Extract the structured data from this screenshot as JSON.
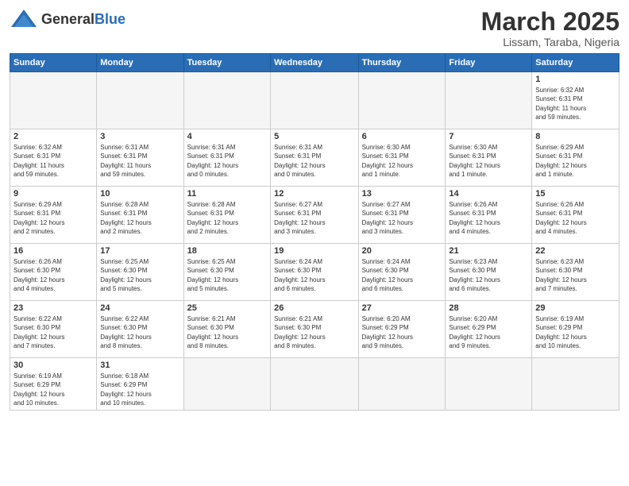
{
  "header": {
    "logo_general": "General",
    "logo_blue": "Blue",
    "month_year": "March 2025",
    "location": "Lissam, Taraba, Nigeria"
  },
  "weekdays": [
    "Sunday",
    "Monday",
    "Tuesday",
    "Wednesday",
    "Thursday",
    "Friday",
    "Saturday"
  ],
  "weeks": [
    [
      {
        "day": "",
        "info": ""
      },
      {
        "day": "",
        "info": ""
      },
      {
        "day": "",
        "info": ""
      },
      {
        "day": "",
        "info": ""
      },
      {
        "day": "",
        "info": ""
      },
      {
        "day": "",
        "info": ""
      },
      {
        "day": "1",
        "info": "Sunrise: 6:32 AM\nSunset: 6:31 PM\nDaylight: 11 hours\nand 59 minutes."
      }
    ],
    [
      {
        "day": "2",
        "info": "Sunrise: 6:32 AM\nSunset: 6:31 PM\nDaylight: 11 hours\nand 59 minutes."
      },
      {
        "day": "3",
        "info": "Sunrise: 6:31 AM\nSunset: 6:31 PM\nDaylight: 11 hours\nand 59 minutes."
      },
      {
        "day": "4",
        "info": "Sunrise: 6:31 AM\nSunset: 6:31 PM\nDaylight: 12 hours\nand 0 minutes."
      },
      {
        "day": "5",
        "info": "Sunrise: 6:31 AM\nSunset: 6:31 PM\nDaylight: 12 hours\nand 0 minutes."
      },
      {
        "day": "6",
        "info": "Sunrise: 6:30 AM\nSunset: 6:31 PM\nDaylight: 12 hours\nand 1 minute."
      },
      {
        "day": "7",
        "info": "Sunrise: 6:30 AM\nSunset: 6:31 PM\nDaylight: 12 hours\nand 1 minute."
      },
      {
        "day": "8",
        "info": "Sunrise: 6:29 AM\nSunset: 6:31 PM\nDaylight: 12 hours\nand 1 minute."
      }
    ],
    [
      {
        "day": "9",
        "info": "Sunrise: 6:29 AM\nSunset: 6:31 PM\nDaylight: 12 hours\nand 2 minutes."
      },
      {
        "day": "10",
        "info": "Sunrise: 6:28 AM\nSunset: 6:31 PM\nDaylight: 12 hours\nand 2 minutes."
      },
      {
        "day": "11",
        "info": "Sunrise: 6:28 AM\nSunset: 6:31 PM\nDaylight: 12 hours\nand 2 minutes."
      },
      {
        "day": "12",
        "info": "Sunrise: 6:27 AM\nSunset: 6:31 PM\nDaylight: 12 hours\nand 3 minutes."
      },
      {
        "day": "13",
        "info": "Sunrise: 6:27 AM\nSunset: 6:31 PM\nDaylight: 12 hours\nand 3 minutes."
      },
      {
        "day": "14",
        "info": "Sunrise: 6:26 AM\nSunset: 6:31 PM\nDaylight: 12 hours\nand 4 minutes."
      },
      {
        "day": "15",
        "info": "Sunrise: 6:26 AM\nSunset: 6:31 PM\nDaylight: 12 hours\nand 4 minutes."
      }
    ],
    [
      {
        "day": "16",
        "info": "Sunrise: 6:26 AM\nSunset: 6:30 PM\nDaylight: 12 hours\nand 4 minutes."
      },
      {
        "day": "17",
        "info": "Sunrise: 6:25 AM\nSunset: 6:30 PM\nDaylight: 12 hours\nand 5 minutes."
      },
      {
        "day": "18",
        "info": "Sunrise: 6:25 AM\nSunset: 6:30 PM\nDaylight: 12 hours\nand 5 minutes."
      },
      {
        "day": "19",
        "info": "Sunrise: 6:24 AM\nSunset: 6:30 PM\nDaylight: 12 hours\nand 6 minutes."
      },
      {
        "day": "20",
        "info": "Sunrise: 6:24 AM\nSunset: 6:30 PM\nDaylight: 12 hours\nand 6 minutes."
      },
      {
        "day": "21",
        "info": "Sunrise: 6:23 AM\nSunset: 6:30 PM\nDaylight: 12 hours\nand 6 minutes."
      },
      {
        "day": "22",
        "info": "Sunrise: 6:23 AM\nSunset: 6:30 PM\nDaylight: 12 hours\nand 7 minutes."
      }
    ],
    [
      {
        "day": "23",
        "info": "Sunrise: 6:22 AM\nSunset: 6:30 PM\nDaylight: 12 hours\nand 7 minutes."
      },
      {
        "day": "24",
        "info": "Sunrise: 6:22 AM\nSunset: 6:30 PM\nDaylight: 12 hours\nand 8 minutes."
      },
      {
        "day": "25",
        "info": "Sunrise: 6:21 AM\nSunset: 6:30 PM\nDaylight: 12 hours\nand 8 minutes."
      },
      {
        "day": "26",
        "info": "Sunrise: 6:21 AM\nSunset: 6:30 PM\nDaylight: 12 hours\nand 8 minutes."
      },
      {
        "day": "27",
        "info": "Sunrise: 6:20 AM\nSunset: 6:29 PM\nDaylight: 12 hours\nand 9 minutes."
      },
      {
        "day": "28",
        "info": "Sunrise: 6:20 AM\nSunset: 6:29 PM\nDaylight: 12 hours\nand 9 minutes."
      },
      {
        "day": "29",
        "info": "Sunrise: 6:19 AM\nSunset: 6:29 PM\nDaylight: 12 hours\nand 10 minutes."
      }
    ],
    [
      {
        "day": "30",
        "info": "Sunrise: 6:19 AM\nSunset: 6:29 PM\nDaylight: 12 hours\nand 10 minutes."
      },
      {
        "day": "31",
        "info": "Sunrise: 6:18 AM\nSunset: 6:29 PM\nDaylight: 12 hours\nand 10 minutes."
      },
      {
        "day": "",
        "info": ""
      },
      {
        "day": "",
        "info": ""
      },
      {
        "day": "",
        "info": ""
      },
      {
        "day": "",
        "info": ""
      },
      {
        "day": "",
        "info": ""
      }
    ]
  ]
}
